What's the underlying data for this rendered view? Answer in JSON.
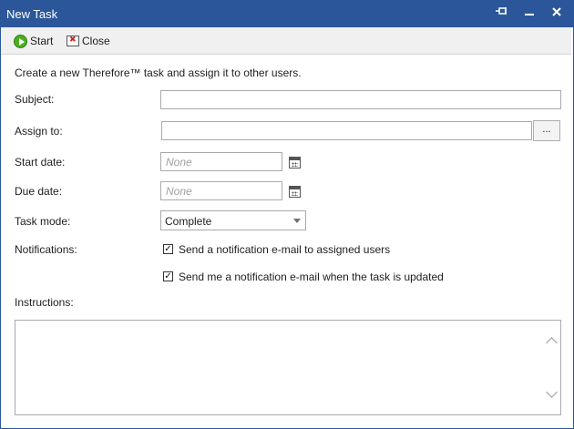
{
  "window": {
    "title": "New Task"
  },
  "toolbar": {
    "start_label": "Start",
    "close_label": "Close"
  },
  "form": {
    "intro": "Create a new Therefore™ task and assign it to other users.",
    "subject_label": "Subject:",
    "subject_value": "",
    "assign_label": "Assign to:",
    "assign_value": "",
    "browse_label": "...",
    "start_date_label": "Start date:",
    "start_date_placeholder": "None",
    "due_date_label": "Due date:",
    "due_date_placeholder": "None",
    "task_mode_label": "Task mode:",
    "task_mode_value": "Complete",
    "notifications_label": "Notifications:",
    "notify_assigned_label": "Send a notification e-mail to assigned users",
    "notify_assigned_checked": true,
    "notify_me_label": "Send me a notification e-mail when the task is updated",
    "notify_me_checked": true,
    "instructions_label": "Instructions:",
    "instructions_value": ""
  },
  "icons": {
    "pin": "pin-icon",
    "minimize": "minimize-icon",
    "close": "close-icon",
    "start": "start-icon",
    "close_tool": "close-document-icon",
    "calendar": "calendar-icon"
  },
  "colors": {
    "titlebar": "#2b579a",
    "start": "#4caf22",
    "close_x": "#d02020"
  }
}
